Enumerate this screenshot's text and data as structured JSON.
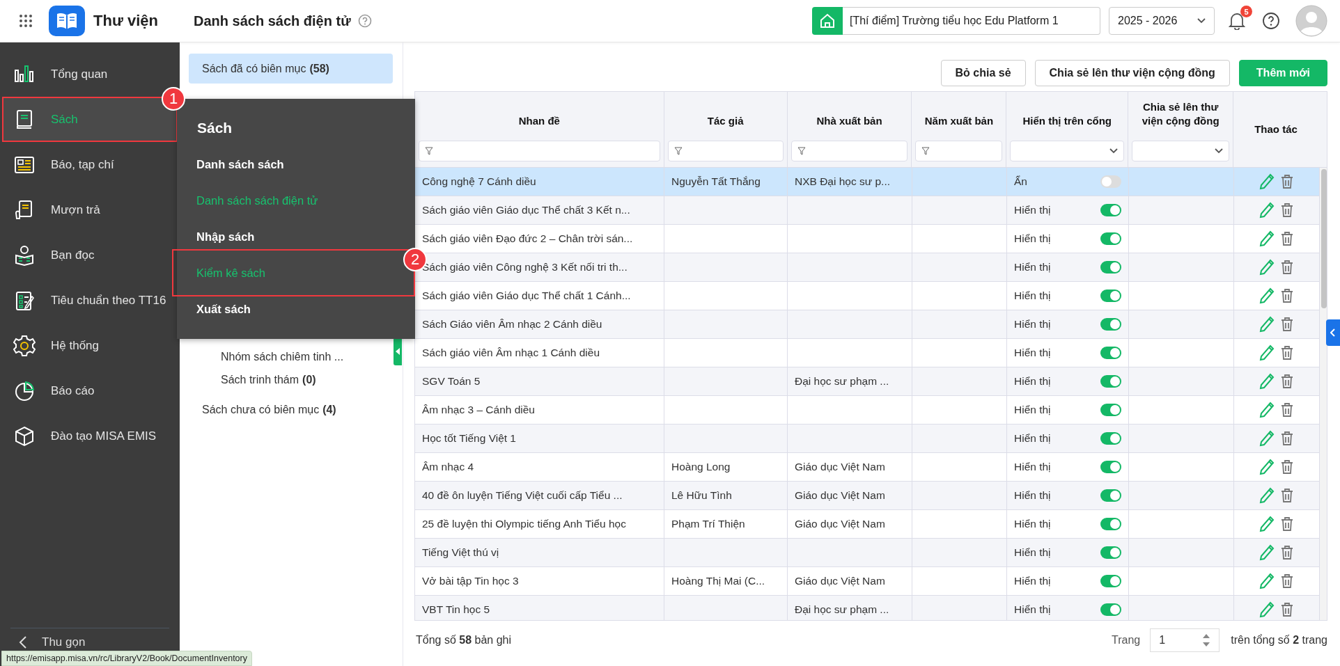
{
  "app": {
    "title": "Thư viện"
  },
  "page_title": "Danh sách sách điện tử",
  "school": "[Thí điểm] Trường tiểu học Edu Platform 1",
  "school_year": "2025 - 2026",
  "notifications": "5",
  "sidebar": {
    "items": [
      {
        "label": "Tổng quan",
        "selected": false
      },
      {
        "label": "Sách",
        "selected": true,
        "callout": "1"
      },
      {
        "label": "Báo, tạp chí",
        "selected": false
      },
      {
        "label": "Mượn trả",
        "selected": false
      },
      {
        "label": "Bạn đọc",
        "selected": false
      },
      {
        "label": "Tiêu chuẩn theo TT16",
        "selected": false
      },
      {
        "label": "Hệ thống",
        "selected": false
      },
      {
        "label": "Báo cáo",
        "selected": false
      },
      {
        "label": "Đào tạo MISA EMIS",
        "selected": false
      }
    ],
    "collapse": "Thu gọn"
  },
  "categories": [
    {
      "label": "Sách đã có biên mục",
      "count": "(58)",
      "selected": true,
      "children": [
        {
          "label": "Nhóm sách chiêm tinh ...",
          "selected": false
        },
        {
          "label": "Sách trinh thám",
          "count": "(0)",
          "selected": false
        }
      ]
    },
    {
      "label": "Sách chưa có biên mục",
      "count": "(4)",
      "selected": false
    }
  ],
  "flyout": {
    "title": "Sách",
    "items": [
      {
        "label": "Danh sách sách",
        "highlighted": false
      },
      {
        "label": "Danh sách sách điện tử",
        "highlighted": true
      },
      {
        "label": "Nhập sách",
        "highlighted": false
      },
      {
        "label": "Kiểm kê sách",
        "highlighted": true,
        "callout": "2"
      },
      {
        "label": "Xuất sách",
        "highlighted": false
      }
    ]
  },
  "actions": [
    {
      "label": "Bỏ chia sẻ",
      "kind": "secondary"
    },
    {
      "label": "Chia sẻ lên thư viện cộng đồng",
      "kind": "secondary"
    },
    {
      "label": "Thêm mới",
      "kind": "primary"
    }
  ],
  "table": {
    "columns": [
      {
        "label": "Nhan đề",
        "kind": "text"
      },
      {
        "label": "Tác giả",
        "kind": "text"
      },
      {
        "label": "Nhà xuất bản",
        "kind": "text"
      },
      {
        "label": "Năm xuất bản",
        "kind": "text"
      },
      {
        "label": "Hiển thị trên cổng",
        "kind": "select"
      },
      {
        "label": "Chia sẻ lên thư viện cộng đồng",
        "kind": "select"
      },
      {
        "label": "Thao tác",
        "kind": "plain"
      }
    ],
    "rows": [
      {
        "title": "Công nghệ 7 Cánh diều",
        "author": "Nguyễn Tất Thắng",
        "publisher": "NXB Đại học sư p...",
        "portal": "Ẩn",
        "portal_on": false,
        "selected": true
      },
      {
        "title": "Sách giáo viên Giáo dục Thể chất 3 Kết n...",
        "portal": "Hiển thị",
        "portal_on": true,
        "selected": false
      },
      {
        "title": "Sách giáo viên Đạo đức 2 – Chân trời sán...",
        "portal": "Hiển thị",
        "portal_on": true,
        "selected": false
      },
      {
        "title": "Sách giáo viên Công nghệ 3 Kết nối tri th...",
        "portal": "Hiển thị",
        "portal_on": true,
        "selected": false
      },
      {
        "title": "Sách giáo viên Giáo dục Thể chất 1 Cánh...",
        "portal": "Hiển thị",
        "portal_on": true,
        "selected": false
      },
      {
        "title": "Sách Giáo viên Âm nhạc 2 Cánh diều",
        "portal": "Hiển thị",
        "portal_on": true,
        "selected": false
      },
      {
        "title": "Sách giáo viên Âm nhạc 1 Cánh diều",
        "portal": "Hiển thị",
        "portal_on": true,
        "selected": false
      },
      {
        "title": "SGV Toán 5",
        "publisher": "Đại học sư phạm ...",
        "portal": "Hiển thị",
        "portal_on": true,
        "selected": false
      },
      {
        "title": "Âm nhạc 3 – Cánh diều",
        "portal": "Hiển thị",
        "portal_on": true,
        "selected": false
      },
      {
        "title": "Học tốt Tiếng Việt 1",
        "portal": "Hiển thị",
        "portal_on": true,
        "selected": false
      },
      {
        "title": "Âm nhạc 4",
        "author": "Hoàng Long",
        "publisher": "Giáo dục Việt Nam",
        "portal": "Hiển thị",
        "portal_on": true,
        "selected": false
      },
      {
        "title": "40 đề ôn luyện Tiếng Việt cuối cấp Tiểu ...",
        "author": "Lê Hữu Tình",
        "publisher": "Giáo dục Việt Nam",
        "portal": "Hiển thị",
        "portal_on": true,
        "selected": false
      },
      {
        "title": "25 đề luyện thi Olympic tiếng Anh Tiểu học",
        "author": "Phạm Trí Thiện",
        "publisher": "Giáo dục Việt Nam",
        "portal": "Hiển thị",
        "portal_on": true,
        "selected": false
      },
      {
        "title": "Tiếng Việt thú vị",
        "portal": "Hiển thị",
        "portal_on": true,
        "selected": false
      },
      {
        "title": "Vở bài tập Tin học 3",
        "author": "Hoàng Thị Mai (C...",
        "publisher": "Giáo dục Việt Nam",
        "portal": "Hiển thị",
        "portal_on": true,
        "selected": false
      },
      {
        "title": "VBT Tin học 5",
        "publisher": "Đại học sư phạm ...",
        "portal": "Hiển thị",
        "portal_on": true,
        "selected": false
      }
    ]
  },
  "footer": {
    "total": "Tổng số **58** bản ghi",
    "page_label": "Trang",
    "page": "1",
    "page_total": "trên tổng số **2** trang"
  },
  "status_url": "https://emisapp.misa.vn/rc/LibraryV2/Book/DocumentInventory"
}
